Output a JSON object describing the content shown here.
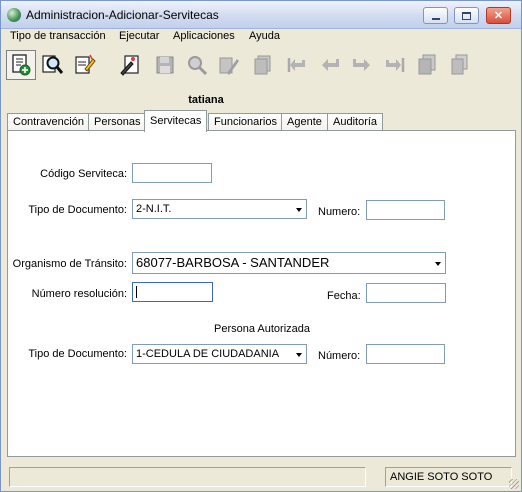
{
  "window": {
    "title": "Administracion-Adicionar-Servitecas",
    "minimize_icon": "minimize-icon",
    "maximize_icon": "maximize-icon",
    "close_icon": "close-icon"
  },
  "menu": {
    "items": [
      {
        "label": "Tipo de transacción"
      },
      {
        "label": "Ejecutar"
      },
      {
        "label": "Aplicaciones"
      },
      {
        "label": "Ayuda"
      }
    ]
  },
  "toolbar": {
    "buttons": [
      {
        "icon": "new-record-icon",
        "enabled": true
      },
      {
        "icon": "search-icon",
        "enabled": true
      },
      {
        "icon": "edit-icon",
        "enabled": true
      },
      {
        "icon": "edit-document-icon",
        "enabled": true
      },
      {
        "icon": "save-icon",
        "enabled": false
      },
      {
        "icon": "delete-search-icon",
        "enabled": false
      },
      {
        "icon": "delete-icon",
        "enabled": false
      },
      {
        "icon": "copy-icon",
        "enabled": false
      },
      {
        "icon": "first-record-icon",
        "enabled": false
      },
      {
        "icon": "previous-record-icon",
        "enabled": false
      },
      {
        "icon": "next-record-icon",
        "enabled": false
      },
      {
        "icon": "last-record-icon",
        "enabled": false
      },
      {
        "icon": "print-icon",
        "enabled": false
      },
      {
        "icon": "report-icon",
        "enabled": false
      }
    ]
  },
  "user": {
    "name": "tatiana"
  },
  "tabs": [
    {
      "label": "Contravención"
    },
    {
      "label": "Personas"
    },
    {
      "label": "Servitecas",
      "active": true
    },
    {
      "label": "Funcionarios"
    },
    {
      "label": "Agente"
    },
    {
      "label": "Auditoría"
    }
  ],
  "form": {
    "codigo_label": "Código Serviteca:",
    "codigo_value": "",
    "tipo_doc_label": "Tipo de Documento:",
    "tipo_doc_value": "2-N.I.T.",
    "numero_label": "Numero:",
    "numero_value": "",
    "organismo_label": "Organismo de Tránsito:",
    "organismo_value": "68077-BARBOSA - SANTANDER",
    "resolucion_label": "Número resolución:",
    "resolucion_value": "",
    "fecha_label": "Fecha:",
    "fecha_value": "",
    "persona_section": "Persona Autorizada",
    "persona_tipo_label": "Tipo de Documento:",
    "persona_tipo_value": "1-CEDULA DE CIUDADANIA",
    "persona_numero_label": "Número:",
    "persona_numero_value": ""
  },
  "status": {
    "left": "",
    "user": "ANGIE  SOTO SOTO"
  }
}
